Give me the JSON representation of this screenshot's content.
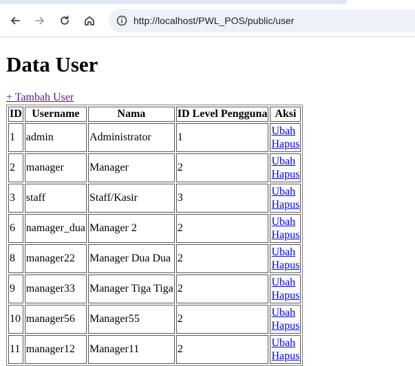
{
  "browser": {
    "url": "http://localhost/PWL_POS/public/user",
    "icons": [
      "back-arrow-icon",
      "forward-arrow-icon",
      "reload-icon",
      "home-icon",
      "site-info-icon"
    ]
  },
  "page": {
    "title": "Data User",
    "add_link": "+ Tambah User"
  },
  "table": {
    "headers": [
      "ID",
      "Username",
      "Nama",
      "ID Level Pengguna",
      "Aksi"
    ],
    "action_edit": "Ubah",
    "action_delete": "Hapus",
    "rows": [
      {
        "id": "1",
        "username": "admin",
        "nama": "Administrator",
        "level": "1"
      },
      {
        "id": "2",
        "username": "manager",
        "nama": "Manager",
        "level": "2"
      },
      {
        "id": "3",
        "username": "staff",
        "nama": "Staff/Kasir",
        "level": "3"
      },
      {
        "id": "6",
        "username": "namager_dua",
        "nama": "Manager 2",
        "level": "2"
      },
      {
        "id": "8",
        "username": "manager22",
        "nama": "Manager Dua Dua",
        "level": "2"
      },
      {
        "id": "9",
        "username": "manager33",
        "nama": "Manager Tiga Tiga",
        "level": "2"
      },
      {
        "id": "10",
        "username": "manager56",
        "nama": "Manager55",
        "level": "2"
      },
      {
        "id": "11",
        "username": "manager12",
        "nama": "Manager11",
        "level": "2"
      }
    ]
  }
}
